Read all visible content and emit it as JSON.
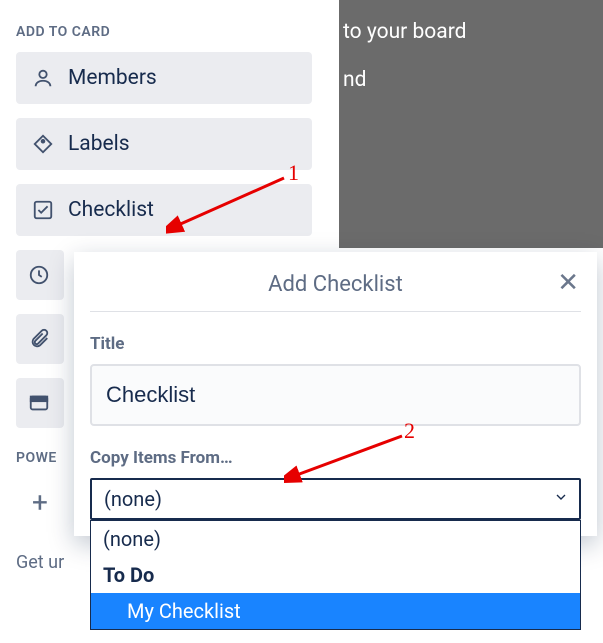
{
  "backdrop": {
    "line1": "to your board",
    "line2": "nd"
  },
  "sidebar": {
    "section1_title": "ADD TO CARD",
    "items": [
      {
        "label": "Members"
      },
      {
        "label": "Labels"
      },
      {
        "label": "Checklist"
      }
    ],
    "section2_title": "POWE",
    "bottom_text": "Get ur"
  },
  "popover": {
    "title": "Add Checklist",
    "title_label": "Title",
    "title_value": "Checklist",
    "copy_label": "Copy Items From…",
    "select_value": "(none)",
    "options": [
      {
        "label": "(none)",
        "style": "normal"
      },
      {
        "label": "To Do",
        "style": "bold"
      },
      {
        "label": "My Checklist",
        "style": "highlight"
      }
    ]
  },
  "annotations": {
    "num1": "1",
    "num2": "2"
  }
}
